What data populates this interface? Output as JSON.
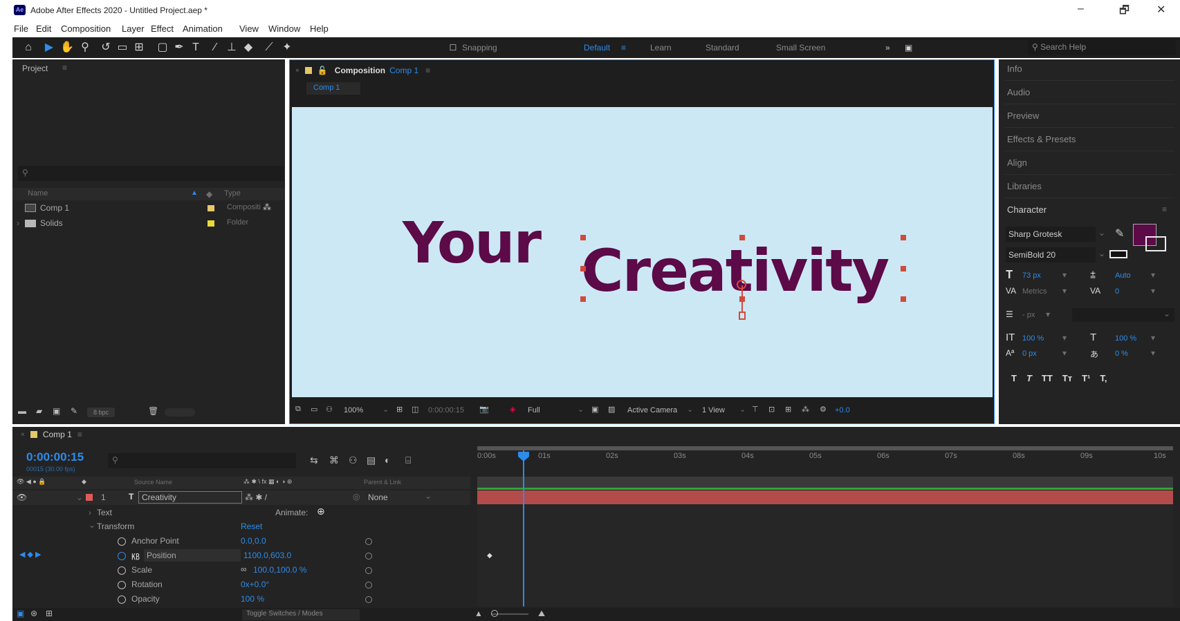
{
  "window": {
    "title": "Adobe After Effects 2020 - Untitled Project.aep *",
    "app_icon": "Ae",
    "controls": [
      "–",
      "🗗",
      "✕"
    ]
  },
  "menu": [
    "File",
    "Edit",
    "Composition",
    "Layer",
    "Effect",
    "Animation",
    "View",
    "Window",
    "Help"
  ],
  "toolbar": {
    "snapping": "Snapping",
    "workspaces": [
      "Default",
      "Learn",
      "Standard",
      "Small Screen"
    ],
    "active_workspace": "Default",
    "more": "»",
    "search_placeholder": "Search Help"
  },
  "project": {
    "title": "Project",
    "columns": {
      "name": "Name",
      "type": "Type"
    },
    "items": [
      {
        "name": "Comp 1",
        "type": "Compositi",
        "label_color": "#e3c76a"
      },
      {
        "name": "Solids",
        "type": "Folder",
        "label_color": "#e7d93b"
      }
    ],
    "bpc": "8 bpc"
  },
  "composition": {
    "panel_label": "Composition",
    "comp_name": "Comp 1",
    "tab": "Comp 1",
    "background": "#cce8f4",
    "text_color": "#5c0a48",
    "words": [
      "Your",
      "Creativity"
    ],
    "footer": {
      "zoom": "100%",
      "time": "0:00:00:15",
      "quality": "Full",
      "camera": "Active Camera",
      "views": "1 View",
      "exposure": "+0.0"
    }
  },
  "right_panel": {
    "items": [
      "Info",
      "Audio",
      "Preview",
      "Effects & Presets",
      "Align",
      "Libraries"
    ],
    "character": {
      "title": "Character",
      "font": "Sharp Grotesk",
      "style": "SemiBold 20",
      "size": "73 px",
      "leading": "Auto",
      "kerning": "Metrics",
      "tracking": "0",
      "stroke": "- px",
      "vscale": "100 %",
      "hscale": "100 %",
      "baseline": "0 px",
      "tsume": "0 %",
      "fill_color": "#5c0a48",
      "styles": [
        "T",
        "T",
        "TT",
        "Tт",
        "T¹",
        "T,"
      ]
    }
  },
  "timeline": {
    "comp_tab": "Comp 1",
    "timecode": "0:00:00:15",
    "frames": "00015 (30.00 fps)",
    "col_source": "Source Name",
    "col_parent": "Parent & Link",
    "layer": {
      "index": "1",
      "name": "Creativity",
      "parent": "None"
    },
    "props": {
      "text": "Text",
      "animate": "Animate:",
      "transform": "Transform",
      "reset": "Reset",
      "anchor_label": "Anchor Point",
      "anchor_value": "0.0,0.0",
      "position_label": "Position",
      "position_value": "1100.0,603.0",
      "scale_label": "Scale",
      "scale_value": "100.0,100.0 %",
      "rotation_label": "Rotation",
      "rotation_value": "0x+0.0°",
      "opacity_label": "Opacity",
      "opacity_value": "100 %"
    },
    "ruler": [
      "0:00s",
      "01s",
      "02s",
      "03s",
      "04s",
      "05s",
      "06s",
      "07s",
      "08s",
      "09s",
      "10s"
    ],
    "toggle": "Toggle Switches / Modes"
  }
}
